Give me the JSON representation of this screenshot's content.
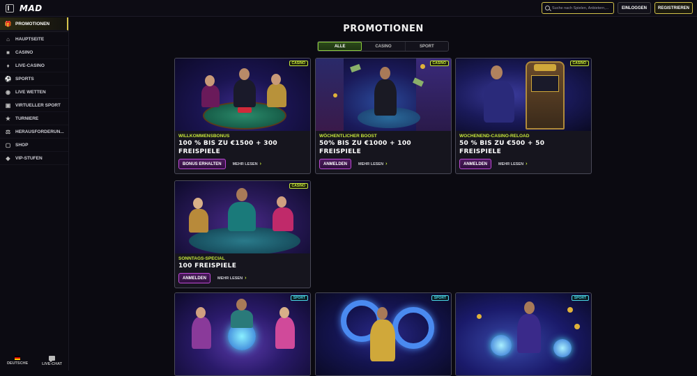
{
  "topbar": {
    "logo": "MAD",
    "search_placeholder": "Suche nach Spielen, Anbietern,...",
    "login_label": "EINLOGGEN",
    "register_label": "REGISTRIEREN"
  },
  "sidebar": {
    "items": [
      {
        "label": "PROMOTIONEN",
        "icon": "gift-icon"
      },
      {
        "label": "HAUPTSEITE",
        "icon": "home-icon"
      },
      {
        "label": "CASINO",
        "icon": "casino-icon"
      },
      {
        "label": "LIVE-CASINO",
        "icon": "live-casino-icon"
      },
      {
        "label": "SPORTS",
        "icon": "ball-icon"
      },
      {
        "label": "LIVE WETTEN",
        "icon": "live-bet-icon"
      },
      {
        "label": "VIRTUELLER SPORT",
        "icon": "virtual-sport-icon"
      },
      {
        "label": "TURNIERE",
        "icon": "trophy-icon"
      },
      {
        "label": "HERAUSFORDERUN...",
        "icon": "challenge-icon"
      },
      {
        "label": "SHOP",
        "icon": "shop-icon"
      },
      {
        "label": "VIP-STUFEN",
        "icon": "vip-icon"
      }
    ],
    "footer": {
      "language": "DEUTSCHE",
      "chat": "LIVE-CHAT"
    }
  },
  "main": {
    "title": "PROMOTIONEN",
    "tabs": [
      {
        "label": "ALLE",
        "active": true
      },
      {
        "label": "CASINO",
        "active": false
      },
      {
        "label": "SPORT",
        "active": false
      }
    ],
    "cards": [
      {
        "badge": "CASINO",
        "subtitle": "WILLKOMMENSBONUS",
        "title": "100 % BIS ZU €1500 + 300 FREISPIELE",
        "cta": "BONUS ERHALTEN",
        "more": "MEHR LESEN"
      },
      {
        "badge": "CASINO",
        "subtitle": "WÖCHENTLICHER BOOST",
        "title": "50% BIS ZU €1000 + 100 FREISPIELE",
        "cta": "ANMELDEN",
        "more": "MEHR LESEN"
      },
      {
        "badge": "CASINO",
        "subtitle": "WOCHENEND-CASINO-RELOAD",
        "title": "50 % BIS ZU €500 + 50 FREISPIELE",
        "cta": "ANMELDEN",
        "more": "MEHR LESEN"
      },
      {
        "badge": "CASINO",
        "subtitle": "SONNTAGS-SPECIAL",
        "title": "100 FREISPIELE",
        "cta": "ANMELDEN",
        "more": "MEHR LESEN"
      },
      {
        "badge": "SPORT"
      },
      {
        "badge": "SPORT"
      },
      {
        "badge": "SPORT"
      }
    ]
  },
  "colors": {
    "accent_yellow": "#d4c34a",
    "lime": "#c8e83a",
    "purple": "#c04bd8",
    "cyan": "#4ad6e8"
  }
}
